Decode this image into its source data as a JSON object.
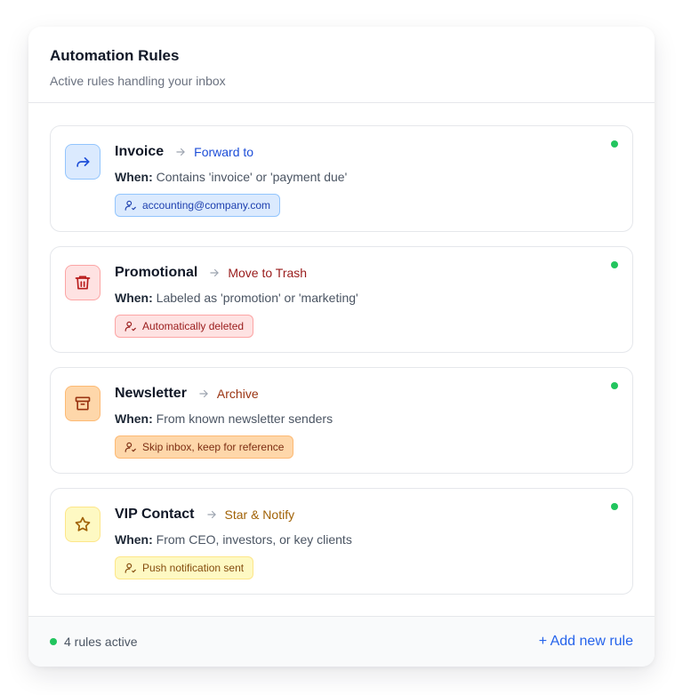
{
  "header": {
    "title": "Automation Rules",
    "subtitle": "Active rules handling your inbox"
  },
  "rules": [
    {
      "name": "Invoice",
      "action": "Forward to",
      "when_label": "When:",
      "when_text": "Contains 'invoice' or 'payment due'",
      "badge": "accounting@company.com",
      "icon": "forward-arrow-icon",
      "active": true,
      "colors": {
        "icon_bg": "#dbeafe",
        "icon_border": "#93c5fd",
        "icon_fg": "#1d4ed8",
        "action": "#1d4ed8",
        "badge_bg": "#dbeafe",
        "badge_border": "#93c5fd",
        "badge_fg": "#1e40af"
      }
    },
    {
      "name": "Promotional",
      "action": "Move to Trash",
      "when_label": "When:",
      "when_text": "Labeled as 'promotion' or 'marketing'",
      "badge": "Automatically deleted",
      "icon": "trash-icon",
      "active": true,
      "colors": {
        "icon_bg": "#fee2e2",
        "icon_border": "#fca5a5",
        "icon_fg": "#b91c1c",
        "action": "#991b1b",
        "badge_bg": "#fee2e2",
        "badge_border": "#fca5a5",
        "badge_fg": "#991b1b"
      }
    },
    {
      "name": "Newsletter",
      "action": "Archive",
      "when_label": "When:",
      "when_text": "From known newsletter senders",
      "badge": "Skip inbox, keep for reference",
      "icon": "archive-box-icon",
      "active": true,
      "colors": {
        "icon_bg": "#fed7aa",
        "icon_border": "#fdba74",
        "icon_fg": "#9a3412",
        "action": "#9a3412",
        "badge_bg": "#fed7aa",
        "badge_border": "#fdba74",
        "badge_fg": "#7c2d12"
      }
    },
    {
      "name": "VIP Contact",
      "action": "Star & Notify",
      "when_label": "When:",
      "when_text": "From CEO, investors, or key clients",
      "badge": "Push notification sent",
      "icon": "star-icon",
      "active": true,
      "colors": {
        "icon_bg": "#fef9c3",
        "icon_border": "#fde68a",
        "icon_fg": "#a16207",
        "action": "#a16207",
        "badge_bg": "#fef9c3",
        "badge_border": "#fde68a",
        "badge_fg": "#854d0e"
      }
    }
  ],
  "footer": {
    "status": "4 rules active",
    "add_label": "+ Add new rule"
  }
}
